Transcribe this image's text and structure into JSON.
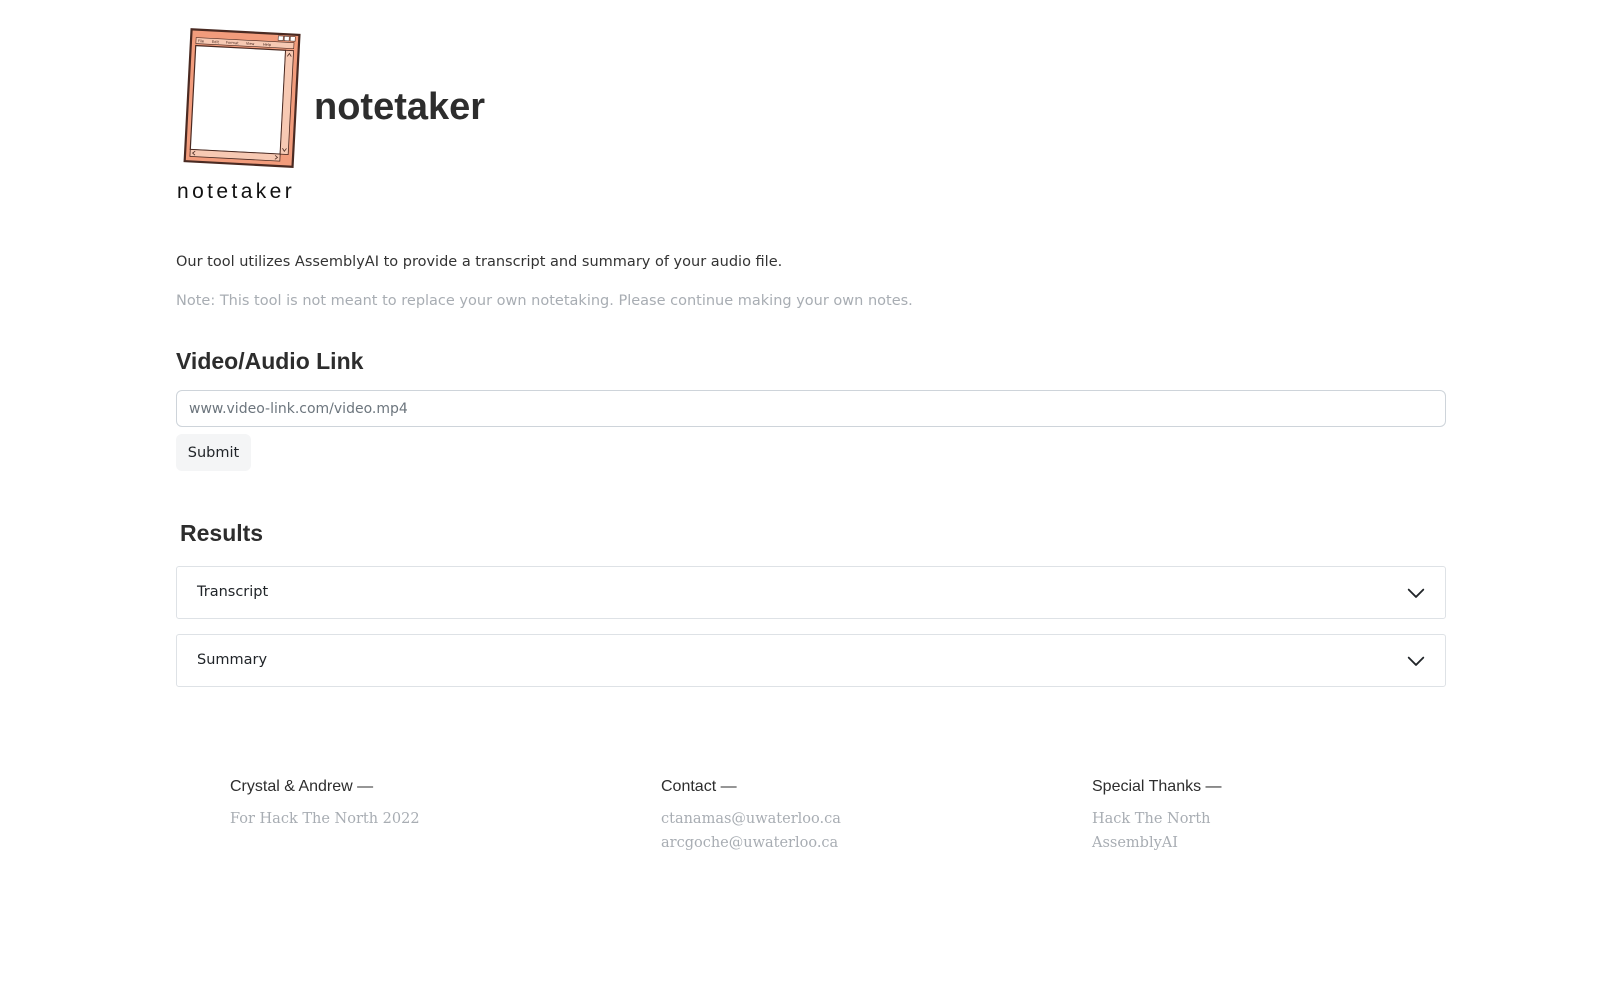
{
  "logo": {
    "icon": "notepad-window-icon",
    "caption": "notetaker",
    "menu": [
      "File",
      "Edit",
      "Format",
      "View",
      "Help"
    ],
    "colors": {
      "frame": "#f29c7c",
      "border": "#4a2a22",
      "paper": "#ffffff"
    }
  },
  "header": {
    "title": "notetaker"
  },
  "intro": {
    "text": "Our tool utilizes AssemblyAI to provide a transcript and summary of your audio file.",
    "note": "Note: This tool is not meant to replace your own notetaking. Please continue making your own notes."
  },
  "link_form": {
    "heading": "Video/Audio Link",
    "placeholder": "www.video-link.com/video.mp4",
    "value": "",
    "submit_label": "Submit"
  },
  "results": {
    "heading": "Results",
    "sections": [
      {
        "label": "Transcript",
        "icon": "chevron-down-icon",
        "expanded": false
      },
      {
        "label": "Summary",
        "icon": "chevron-down-icon",
        "expanded": false
      }
    ]
  },
  "footer": {
    "columns": [
      {
        "heading": "Crystal & Andrew —",
        "lines": [
          "For Hack The North 2022"
        ]
      },
      {
        "heading": "Contact —",
        "lines": [
          "ctanamas@uwaterloo.ca",
          "arcgoche@uwaterloo.ca"
        ]
      },
      {
        "heading": "Special Thanks —",
        "lines": [
          "Hack The North",
          "AssemblyAI"
        ]
      }
    ]
  }
}
